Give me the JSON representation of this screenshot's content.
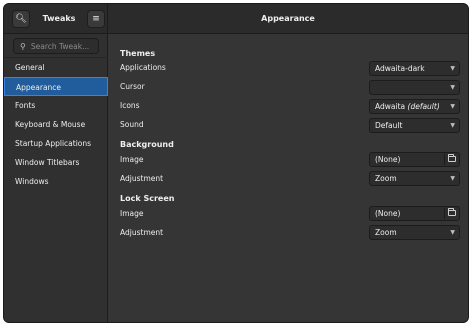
{
  "header": {
    "app_title": "Tweaks",
    "page_title": "Appearance",
    "search_icon": "search-icon",
    "menu_icon": "hamburger-menu-icon"
  },
  "sidebar": {
    "search_placeholder": "Search Tweak...",
    "items": [
      {
        "label": "General",
        "selected": false
      },
      {
        "label": "Appearance",
        "selected": true
      },
      {
        "label": "Fonts",
        "selected": false
      },
      {
        "label": "Keyboard & Mouse",
        "selected": false
      },
      {
        "label": "Startup Applications",
        "selected": false
      },
      {
        "label": "Window Titlebars",
        "selected": false
      },
      {
        "label": "Windows",
        "selected": false
      }
    ]
  },
  "themes": {
    "title": "Themes",
    "applications": {
      "label": "Applications",
      "value": "Adwaita-dark"
    },
    "cursor": {
      "label": "Cursor",
      "value": ""
    },
    "icons": {
      "label": "Icons",
      "value": "Adwaita",
      "value_suffix": "(default)"
    },
    "sound": {
      "label": "Sound",
      "value": "Default"
    }
  },
  "background": {
    "title": "Background",
    "image": {
      "label": "Image",
      "value": "(None)"
    },
    "adjustment": {
      "label": "Adjustment",
      "value": "Zoom"
    }
  },
  "lock_screen": {
    "title": "Lock Screen",
    "image": {
      "label": "Image",
      "value": "(None)"
    },
    "adjustment": {
      "label": "Adjustment",
      "value": "Zoom"
    }
  },
  "colors": {
    "window_bg": "#353535",
    "headerbar_bg": "#2b2b2b",
    "selection": "#215d9c",
    "text": "#eeeeec"
  }
}
